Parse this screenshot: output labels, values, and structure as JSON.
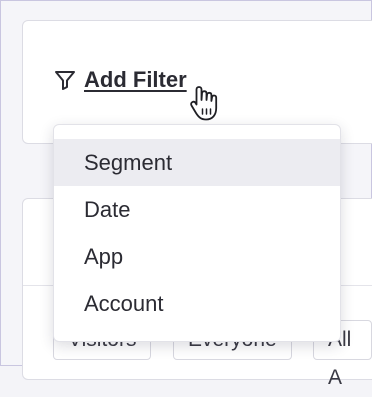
{
  "filter": {
    "add_filter_label": "Add Filter"
  },
  "chips": {
    "visitors": "Visitors",
    "everyone": "Everyone",
    "all_apps": "All A"
  },
  "menu": {
    "items": [
      {
        "label": "Segment",
        "active": true
      },
      {
        "label": "Date",
        "active": false
      },
      {
        "label": "App",
        "active": false
      },
      {
        "label": "Account",
        "active": false
      }
    ]
  },
  "colors": {
    "text": "#2b2b33",
    "hover_bg": "#ececf1",
    "border": "#dcdce4",
    "page_bg": "#f4f4f8"
  },
  "icons": {
    "filter": "funnel-icon",
    "cursor": "hand-pointer-icon"
  }
}
